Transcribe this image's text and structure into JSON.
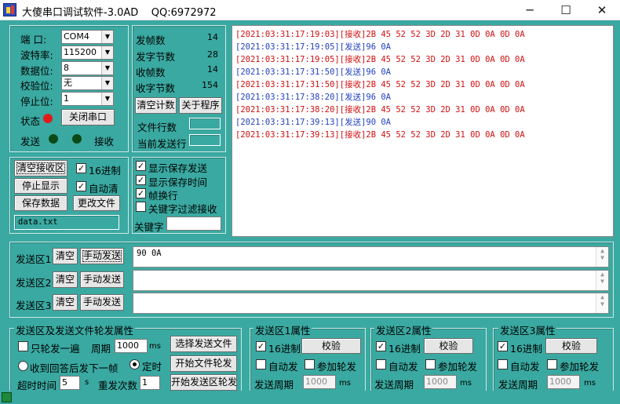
{
  "window": {
    "title": "大傻串口调试软件-3.0AD    QQ:6972972",
    "minimize": "─",
    "maximize": "☐",
    "close": "✕"
  },
  "port": {
    "port_label": "端  口:",
    "port_value": "COM4",
    "baud_label": "波特率:",
    "baud_value": "115200",
    "data_label": "数据位:",
    "data_value": "8",
    "parity_label": "校验位:",
    "parity_value": "无",
    "stop_label": "停止位:",
    "stop_value": "1",
    "state_label": "状态",
    "close_button": "关闭串口",
    "send_label": "发送",
    "recv_label": "接收",
    "colors": {
      "state": "#e11a1a",
      "led_off": "#0a4a16"
    }
  },
  "stats": {
    "frames_sent_label": "发帧数",
    "frames_sent": "14",
    "bytes_sent_label": "发字节数",
    "bytes_sent": "28",
    "frames_recv_label": "收帧数",
    "frames_recv": "14",
    "bytes_recv_label": "收字节数",
    "bytes_recv": "154",
    "clear_count_button": "清空计数",
    "about_button": "关于程序",
    "file_lines_label": "文件行数",
    "current_line_label": "当前发送行"
  },
  "recv_controls": {
    "clear_button": "清空接收区",
    "hex_label": "16进制",
    "hex_checked": true,
    "stop_display_button": "停止显示",
    "auto_clear_label": "自动清",
    "auto_clear_checked": true,
    "save_data_button": "保存数据",
    "change_file_button": "更改文件",
    "file_name": "data.txt"
  },
  "display_opts": {
    "show_save_send": "显示保存发送",
    "show_save_send_checked": true,
    "show_save_time": "显示保存时间",
    "show_save_time_checked": true,
    "frame_newline": "帧换行",
    "frame_newline_checked": true,
    "keyword_filter": "关键字过滤接收",
    "keyword_filter_checked": false,
    "keyword_label": "关键字"
  },
  "log": [
    {
      "type": "recv",
      "text": "[2021:03:31:17:19:03][接收]2B 45 52 52 3D 2D 31 0D 0A 0D 0A"
    },
    {
      "type": "send",
      "text": "[2021:03:31:17:19:05][发送]96 0A"
    },
    {
      "type": "recv",
      "text": "[2021:03:31:17:19:05][接收]2B 45 52 52 3D 2D 31 0D 0A 0D 0A"
    },
    {
      "type": "send",
      "text": "[2021:03:31:17:31:50][发送]96 0A"
    },
    {
      "type": "recv",
      "text": "[2021:03:31:17:31:50][接收]2B 45 52 52 3D 2D 31 0D 0A 0D 0A"
    },
    {
      "type": "send",
      "text": "[2021:03:31:17:38:20][发送]96 0A"
    },
    {
      "type": "recv",
      "text": "[2021:03:31:17:38:20][接收]2B 45 52 52 3D 2D 31 0D 0A 0D 0A"
    },
    {
      "type": "send",
      "text": "[2021:03:31:17:39:13][发送]90 0A"
    },
    {
      "type": "recv",
      "text": "[2021:03:31:17:39:13][接收]2B 45 52 52 3D 2D 31 0D 0A 0D 0A"
    }
  ],
  "log_colors": {
    "recv": "#d01010",
    "send": "#1f3fbf"
  },
  "send_areas": [
    {
      "label": "发送区1",
      "clear": "清空",
      "send": "手动发送",
      "content": "90 0A"
    },
    {
      "label": "发送区2",
      "clear": "清空",
      "send": "手动发送",
      "content": ""
    },
    {
      "label": "发送区3",
      "clear": "清空",
      "send": "手动发送",
      "content": ""
    }
  ],
  "rotation": {
    "title": "发送区及发送文件轮发属性",
    "only_once": "只轮发一遍",
    "only_once_checked": false,
    "period_label": "周期",
    "period_value": "1000",
    "ms": "ms",
    "select_file_button": "选择发送文件",
    "reply_next": "收到回答后发下一帧",
    "timed": "定时",
    "timed_selected": true,
    "start_file_button": "开始文件轮发",
    "timeout_label": "超时时间",
    "timeout_value": "5",
    "s": "s",
    "resend_label": "重发次数",
    "resend_value": "1",
    "start_area_button": "开始发送区轮发"
  },
  "area_props": [
    {
      "title": "发送区1属性",
      "hex": "16进制",
      "hex_checked": true,
      "verify": "校验",
      "auto": "自动发",
      "auto_checked": false,
      "join": "参加轮发",
      "join_checked": false,
      "period_label": "发送周期",
      "period_value": "1000",
      "ms": "ms"
    },
    {
      "title": "发送区2属性",
      "hex": "16进制",
      "hex_checked": true,
      "verify": "校验",
      "auto": "自动发",
      "auto_checked": false,
      "join": "参加轮发",
      "join_checked": false,
      "period_label": "发送周期",
      "period_value": "1000",
      "ms": "ms"
    },
    {
      "title": "发送区3属性",
      "hex": "16进制",
      "hex_checked": true,
      "verify": "校验",
      "auto": "自动发",
      "auto_checked": false,
      "join": "参加轮发",
      "join_checked": false,
      "period_label": "发送周期",
      "period_value": "1000",
      "ms": "ms"
    }
  ]
}
